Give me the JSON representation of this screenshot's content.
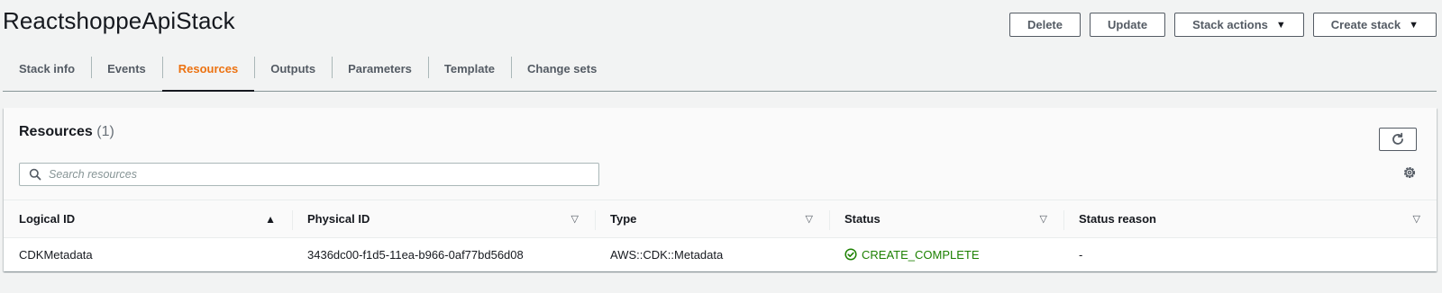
{
  "header": {
    "title": "ReactshoppeApiStack",
    "actions": {
      "delete": "Delete",
      "update": "Update",
      "stack_actions": "Stack actions",
      "create_stack": "Create stack"
    }
  },
  "tabs": [
    {
      "label": "Stack info"
    },
    {
      "label": "Events"
    },
    {
      "label": "Resources",
      "active": true
    },
    {
      "label": "Outputs"
    },
    {
      "label": "Parameters"
    },
    {
      "label": "Template"
    },
    {
      "label": "Change sets"
    }
  ],
  "resources": {
    "title": "Resources",
    "count": "(1)",
    "search_placeholder": "Search resources",
    "search_value": "",
    "columns": [
      "Logical ID",
      "Physical ID",
      "Type",
      "Status",
      "Status reason"
    ],
    "rows": [
      {
        "logical_id": "CDKMetadata",
        "physical_id": "3436dc00-f1d5-11ea-b966-0af77bd56d08",
        "type": "AWS::CDK::Metadata",
        "status": "CREATE_COMPLETE",
        "status_reason": "-"
      }
    ]
  },
  "icons": {
    "refresh": "refresh-icon",
    "search": "search-icon",
    "settings": "gear-icon",
    "status": "check-circle-icon"
  },
  "colors": {
    "accent": "#ec7211",
    "success": "#1d8102",
    "background": "#f2f3f3"
  }
}
